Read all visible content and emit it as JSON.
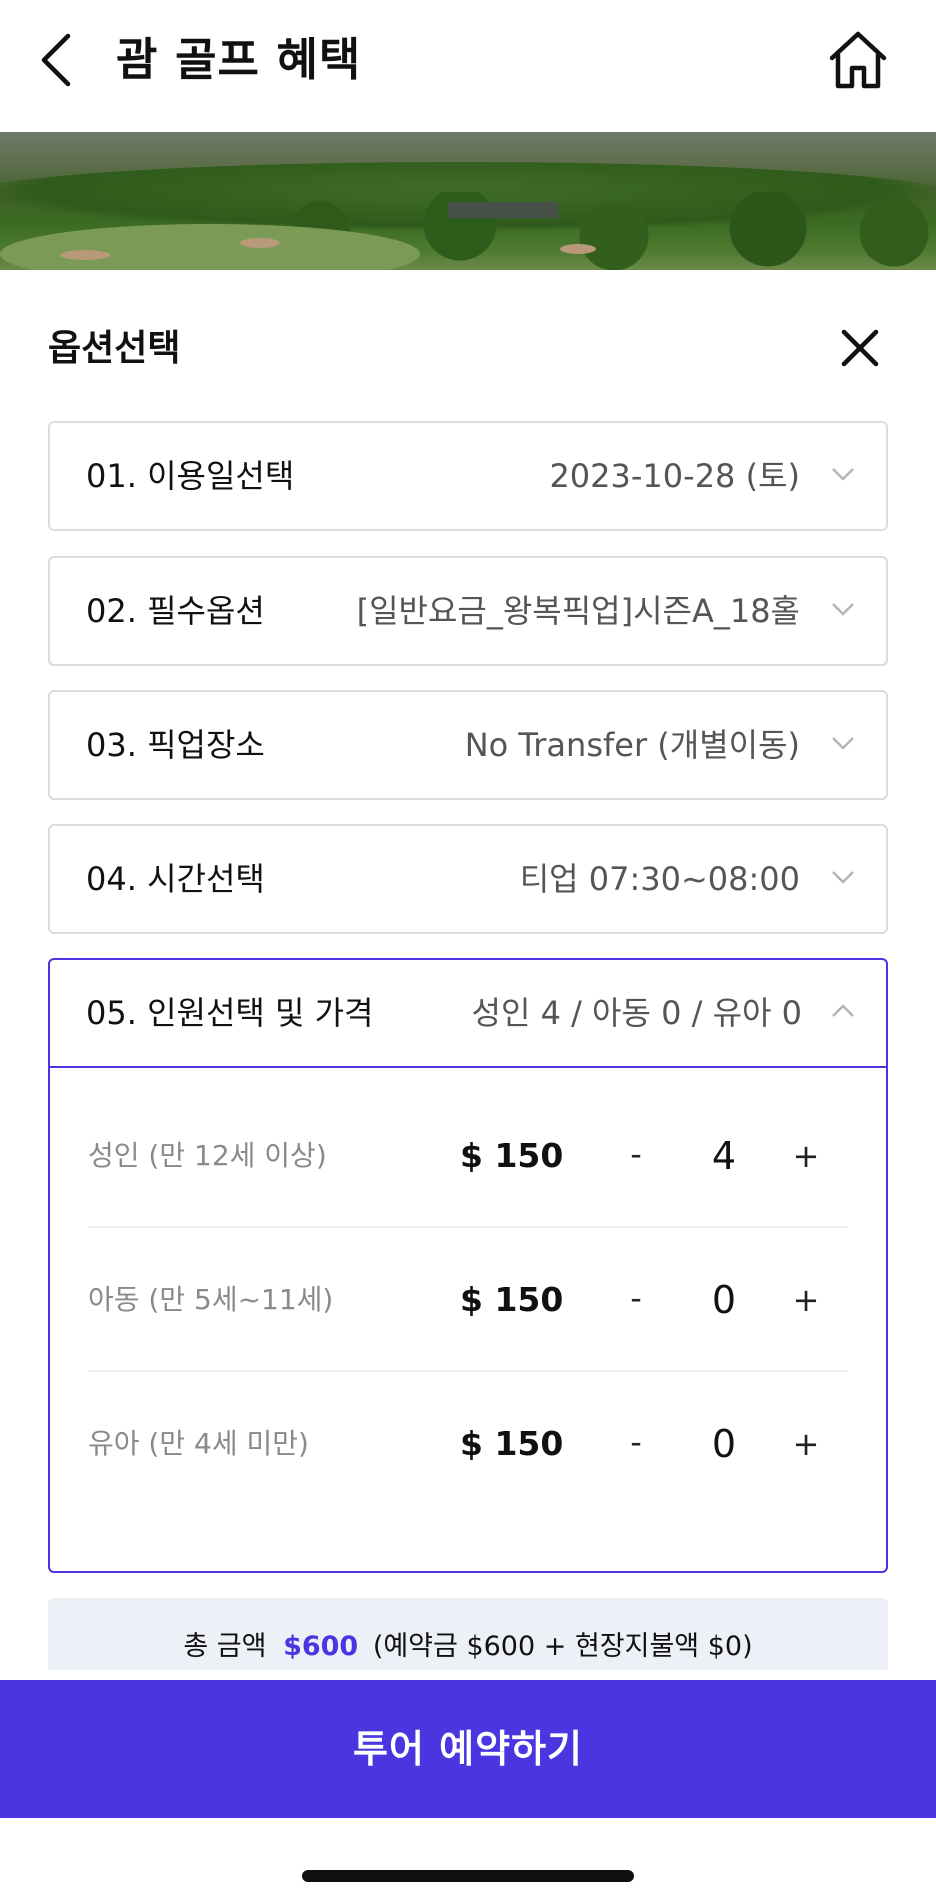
{
  "header": {
    "title": "괌 골프 혜택",
    "back_icon": "chevron-left-icon",
    "home_icon": "home-icon"
  },
  "sheet": {
    "title": "옵션선택",
    "close_icon": "close-icon",
    "options": [
      {
        "label": "01. 이용일선택",
        "value": "2023-10-28 (토)"
      },
      {
        "label": "02. 필수옵션",
        "value": "[일반요금_왕복픽업]시즌A_18홀"
      },
      {
        "label": "03. 픽업장소",
        "value": "No Transfer (개별이동)"
      },
      {
        "label": "04. 시간선택",
        "value": "티업 07:30~08:00"
      }
    ],
    "persons": {
      "label": "05. 인원선택 및 가격",
      "summary": "성인 4 / 아동 0 / 유아 0",
      "rows": [
        {
          "label": "성인 (만 12세 이상)",
          "price": "$ 150",
          "minus": "-",
          "qty": "4",
          "plus": "+"
        },
        {
          "label": "아동 (만 5세~11세)",
          "price": "$ 150",
          "minus": "-",
          "qty": "0",
          "plus": "+"
        },
        {
          "label": "유아 (만 4세 미만)",
          "price": "$ 150",
          "minus": "-",
          "qty": "0",
          "plus": "+"
        }
      ]
    },
    "total": {
      "prefix": "총 금액",
      "amount": "$600",
      "detail": "(예약금 $600 + 현장지불액 $0)"
    }
  },
  "footer": {
    "book_label": "투어 예약하기"
  },
  "colors": {
    "accent": "#4a35e0",
    "border": "#dcdcdc",
    "summary_bg": "#eef0f7"
  }
}
